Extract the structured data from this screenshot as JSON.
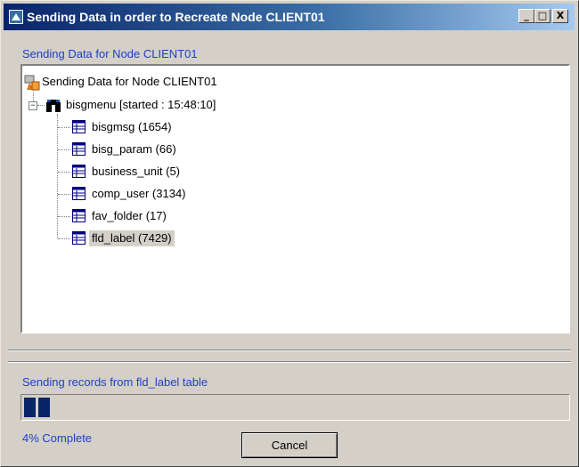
{
  "window": {
    "title": "Sending Data in order to Recreate Node CLIENT01"
  },
  "titlebar_buttons": {
    "minimize": "_",
    "maximize": "□",
    "close": "X"
  },
  "header_label": "Sending Data for Node CLIENT01",
  "tree": {
    "root": {
      "label": "Sending Data for Node CLIENT01",
      "icon": "node-icon"
    },
    "child": {
      "label": "bisgmenu [started : 15:48:10]",
      "icon": "binoculars-icon",
      "expander": "−"
    },
    "tables": [
      {
        "label": "bisgmsg (1654)",
        "icon": "table-icon"
      },
      {
        "label": "bisg_param (66)",
        "icon": "table-icon"
      },
      {
        "label": "business_unit (5)",
        "icon": "table-icon"
      },
      {
        "label": "comp_user (3134)",
        "icon": "table-icon"
      },
      {
        "label": "fav_folder (17)",
        "icon": "table-icon"
      },
      {
        "label": "fld_label (7429)",
        "icon": "table-icon",
        "selected": true
      }
    ]
  },
  "status_label": "Sending records from fld_label table",
  "progress": {
    "percent": 4,
    "blocks": 2
  },
  "percent_label": "4% Complete",
  "cancel_label": "Cancel",
  "colors": {
    "title_gradient_start": "#0a246a",
    "label_blue": "#1f3fc7",
    "progress_block": "#0a246a",
    "face": "#d4d0c8"
  }
}
